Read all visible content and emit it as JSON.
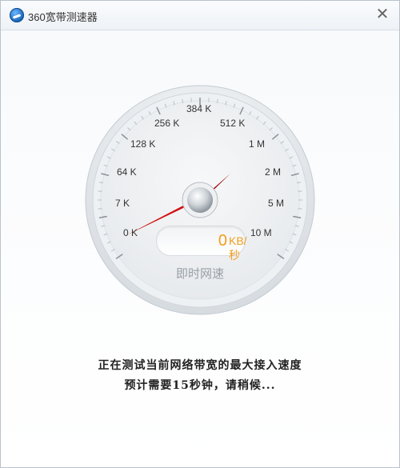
{
  "window": {
    "title": "360宽带测速器",
    "close_icon": "close-icon",
    "app_icon": "360-broadband-icon"
  },
  "gauge": {
    "scale_labels": [
      "0 K",
      "7 K",
      "64 K",
      "128 K",
      "256 K",
      "384 K",
      "512 K",
      "1 M",
      "2 M",
      "5 M",
      "10 M"
    ],
    "speed_value": "0",
    "speed_unit": "KB/秒",
    "realtime_label": "即时网速",
    "needle_color": "#cc0000",
    "value_color": "#f29d1d"
  },
  "status": {
    "line1": "正在测试当前网络带宽的最大接入速度",
    "line2": "预计需要15秒钟，请稍候..."
  }
}
